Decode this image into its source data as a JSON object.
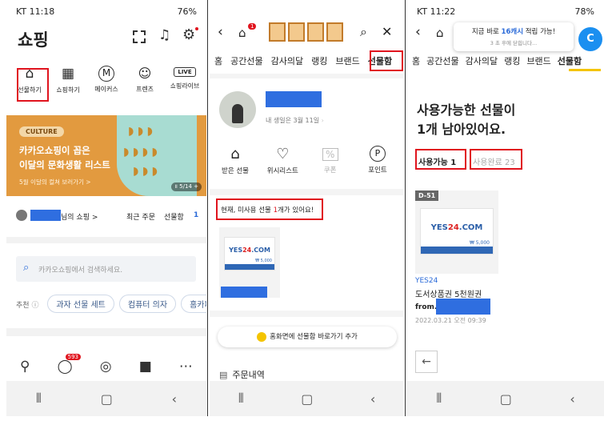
{
  "panel1": {
    "status": {
      "time": "KT 11:18",
      "battery": "76%"
    },
    "title": "쇼핑",
    "categories": [
      {
        "icon": "gift-box-icon",
        "label": "선물하기"
      },
      {
        "icon": "store-icon",
        "label": "쇼핑하기"
      },
      {
        "icon": "makers-m-icon",
        "label": "메이커스"
      },
      {
        "icon": "friends-pig-icon",
        "label": "프렌즈"
      },
      {
        "icon": "live-icon",
        "label": "쇼핑라이브"
      }
    ],
    "banner": {
      "badge": "CULTURE",
      "line1": "카카오쇼핑이 꼽은",
      "line2": "이달의 문화생활 리스트",
      "sub": "5월 이달의 컬쳐 보러가기 >",
      "pager": "5/14",
      "bg": "#e29a3f"
    },
    "user": {
      "name_suffix": "님의 쇼핑 >",
      "recent_order": "최근 주문",
      "gift_box": "선물함",
      "gift_count": "1"
    },
    "search": {
      "placeholder": "카카오쇼핑에서 검색하세요."
    },
    "recommend": {
      "label": "추천",
      "chips": [
        "과자 선물 세트",
        "컴퓨터 의자",
        "홈카페 용"
      ]
    },
    "bottom_nav": {
      "chat_badge": "593"
    }
  },
  "panel2": {
    "tabs": [
      "홈",
      "공간선물",
      "감사의달",
      "랭킹",
      "브랜드",
      "선물함"
    ],
    "birthday": "내 생일은 3월 11일",
    "menu": [
      {
        "icon": "gift-icon",
        "label": "받은 선물"
      },
      {
        "icon": "heart-icon",
        "label": "위시리스트"
      },
      {
        "icon": "coupon-icon",
        "label": "쿠폰"
      },
      {
        "icon": "point-icon",
        "label": "포인트"
      }
    ],
    "notice_prefix": "현재, 미사용 선물 ",
    "notice_count": "1",
    "notice_suffix": "개가 있어요!",
    "voucher_brand": "YES24",
    "voucher_price": "₩ 5,000",
    "shortcut": "홈화면에 선물함 바로가기 추가",
    "order_history": "주문내역",
    "cart_badge": "1"
  },
  "panel3": {
    "status": {
      "time": "KT 11:22",
      "battery": "78%"
    },
    "toast_prefix": "지금 바로 ",
    "toast_highlight": "16캐시",
    "toast_suffix": " 적립 가능!",
    "toast_sub": "3 초 후에 닫힙니다...",
    "tabs": [
      "홈",
      "공간선물",
      "감사의달",
      "랭킹",
      "브랜드",
      "선물함"
    ],
    "heading1": "사용가능한 선물이",
    "heading2": "1개 남아있어요.",
    "available": "사용가능 1",
    "used": "사용완료 23",
    "dday": "D-51",
    "brand": "YES24",
    "product": "도서상품권 5천원권",
    "from": "from.",
    "date": "2022.03.21  오전 09:39",
    "voucher_price": "₩ 5,000",
    "fab_label": "C"
  }
}
